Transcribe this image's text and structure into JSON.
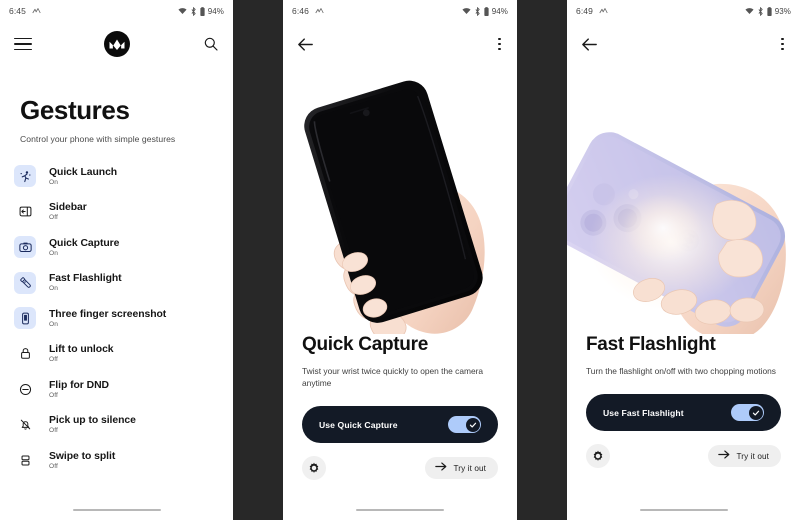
{
  "separator_color": "#282828",
  "accent_blue": "#aecbfa",
  "icon_bg_on": "#dce6fb",
  "card_dark": "#131a26",
  "panels": [
    {
      "id": "gestures-list",
      "status": {
        "time": "6:45",
        "battery_percent": "94%",
        "icons": [
          "app-activity-icon",
          "wifi-icon",
          "bluetooth-icon",
          "battery-icon"
        ]
      },
      "appbar": {
        "menu_icon": "hamburger-menu-icon",
        "logo": "motorola-logo",
        "search_icon": "search-icon"
      },
      "header": {
        "title": "Gestures",
        "subtitle": "Control your phone with simple gestures"
      },
      "items": [
        {
          "label": "Quick Launch",
          "state": "On",
          "icon": "quick-launch-icon",
          "enabled": true
        },
        {
          "label": "Sidebar",
          "state": "Off",
          "icon": "sidebar-icon",
          "enabled": false
        },
        {
          "label": "Quick Capture",
          "state": "On",
          "icon": "camera-icon",
          "enabled": true
        },
        {
          "label": "Fast Flashlight",
          "state": "On",
          "icon": "flashlight-icon",
          "enabled": true
        },
        {
          "label": "Three finger screenshot",
          "state": "On",
          "icon": "screenshot-icon",
          "enabled": true
        },
        {
          "label": "Lift to unlock",
          "state": "Off",
          "icon": "lock-icon",
          "enabled": false
        },
        {
          "label": "Flip for DND",
          "state": "Off",
          "icon": "do-not-disturb-icon",
          "enabled": false
        },
        {
          "label": "Pick up to silence",
          "state": "Off",
          "icon": "bell-off-icon",
          "enabled": false
        },
        {
          "label": "Swipe to split",
          "state": "Off",
          "icon": "split-screen-icon",
          "enabled": false
        }
      ]
    },
    {
      "id": "quick-capture-detail",
      "status": {
        "time": "6:46",
        "battery_percent": "94%"
      },
      "appbar": {
        "back_icon": "back-arrow-icon",
        "overflow_icon": "more-options-icon"
      },
      "hero": {
        "artwork": "hand-holding-black-phone"
      },
      "title": "Quick Capture",
      "description": "Twist your wrist twice quickly to open the camera anytime",
      "toggle": {
        "label": "Use Quick Capture",
        "checked": true,
        "knob_icon": "check-icon"
      },
      "settings_button": {
        "icon": "gear-icon"
      },
      "try_button": {
        "label": "Try it out",
        "icon": "arrow-right-icon"
      }
    },
    {
      "id": "fast-flashlight-detail",
      "status": {
        "time": "6:49",
        "battery_percent": "93%"
      },
      "appbar": {
        "back_icon": "back-arrow-icon",
        "overflow_icon": "more-options-icon"
      },
      "hero": {
        "artwork": "hand-holding-lavender-phone-flashlight"
      },
      "title": "Fast Flashlight",
      "description": "Turn the flashlight on/off with two chopping motions",
      "toggle": {
        "label": "Use Fast Flashlight",
        "checked": true,
        "knob_icon": "check-icon"
      },
      "settings_button": {
        "icon": "gear-icon"
      },
      "try_button": {
        "label": "Try it out",
        "icon": "arrow-right-icon"
      }
    }
  ]
}
